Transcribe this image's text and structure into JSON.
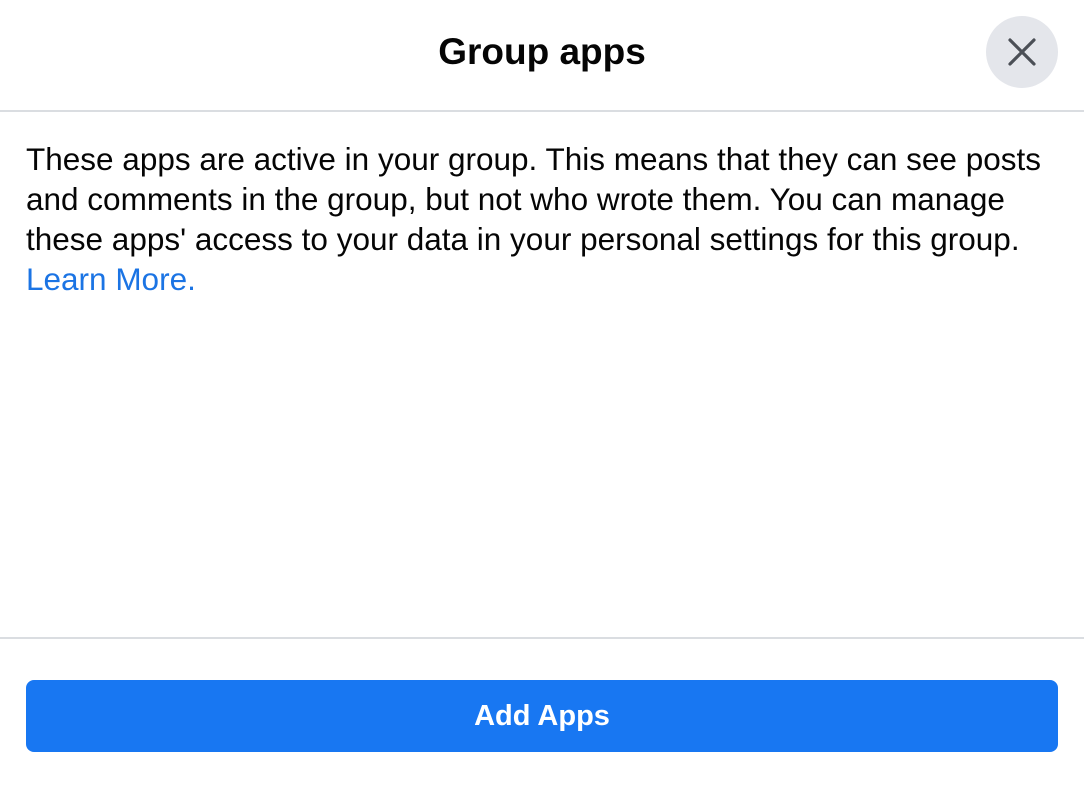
{
  "header": {
    "title": "Group apps",
    "close_icon": "close-icon"
  },
  "content": {
    "description": "These apps are active in your group. This means that they can see posts and comments in the group, but not who wrote them. You can manage these apps' access to your data in your personal settings for this group.",
    "learn_more_label": "Learn More."
  },
  "footer": {
    "add_apps_label": "Add Apps"
  },
  "colors": {
    "primary_button": "#1877f2",
    "link": "#1b74e4",
    "close_button_bg": "#e4e6eb",
    "divider": "#dadde1"
  }
}
